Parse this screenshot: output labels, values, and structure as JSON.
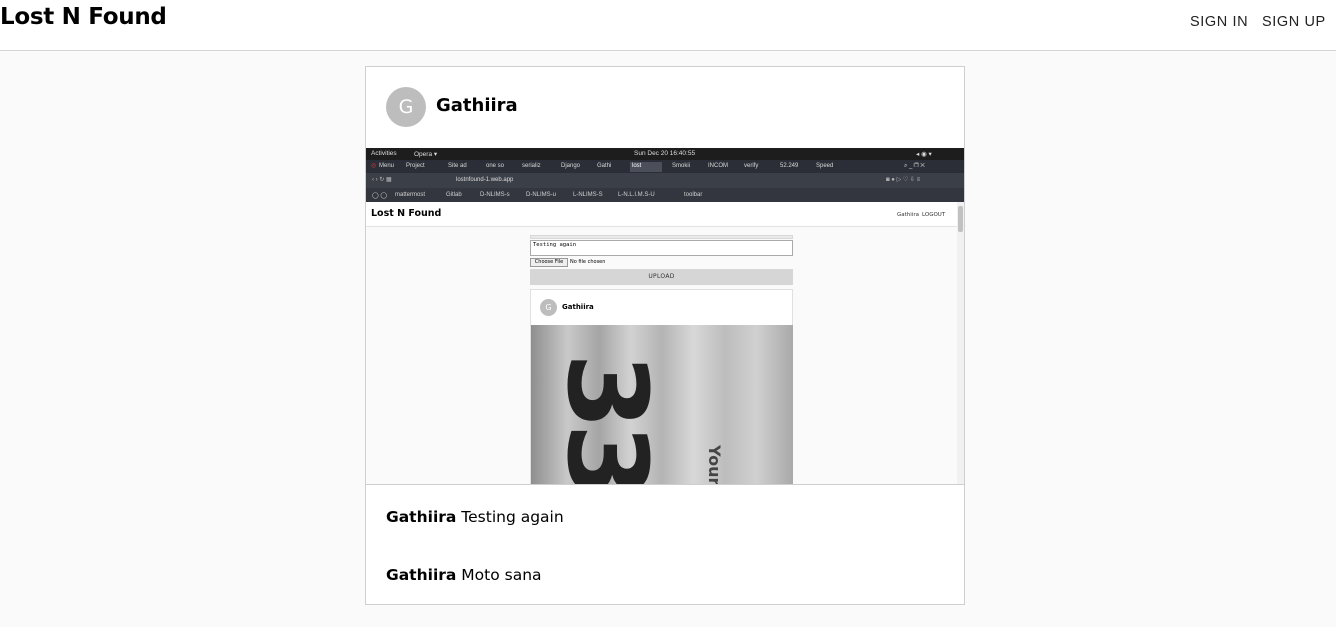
{
  "header": {
    "brand": "Lost N Found",
    "sign_in": "SIGN IN",
    "sign_up": "SIGN UP"
  },
  "post": {
    "avatar_letter": "G",
    "username": "Gathiira",
    "image": {
      "os_bar": {
        "activities": "Activities",
        "browser": "Opera ▾",
        "clock": "Sun Dec 20  16:40:55"
      },
      "tabs": [
        {
          "label": "Menu"
        },
        {
          "label": "Project"
        },
        {
          "label": "Site ad"
        },
        {
          "label": "one so"
        },
        {
          "label": "serializ"
        },
        {
          "label": "Django"
        },
        {
          "label": "Gathi"
        },
        {
          "label": "lost"
        },
        {
          "label": "Smokii"
        },
        {
          "label": "INCOM"
        },
        {
          "label": "verify"
        },
        {
          "label": "52.249"
        },
        {
          "label": "Speed"
        }
      ],
      "url": "lostnfound-1.web.app",
      "bookmarks": [
        "mattermost",
        "Gitlab",
        "D-NLIMS-s",
        "D-NLIMS-u",
        "L-NLIMS-S",
        "L-N.L.I.M.S-U",
        "toolbar"
      ],
      "inner_page": {
        "brand": "Lost N Found",
        "user": "Gathiira",
        "logout": "LOGOUT",
        "textarea_value": "Testing again",
        "file_button": "Choose File",
        "file_status": "No file chosen",
        "upload": "UPLOAD",
        "card_avatar": "G",
        "card_username": "Gathiira",
        "photo_number": "33",
        "photo_text": "Your"
      }
    },
    "comments": [
      {
        "author": "Gathiira",
        "text": "Testing again"
      },
      {
        "author": "Gathiira",
        "text": "Moto sana"
      }
    ]
  }
}
